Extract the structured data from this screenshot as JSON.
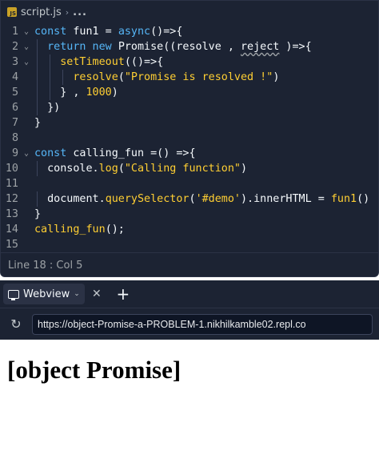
{
  "editor": {
    "breadcrumb": {
      "icon": "js-file-icon",
      "file": "script.js",
      "more": "..."
    },
    "lines": [
      {
        "n": "1",
        "fold": true,
        "indent": 0,
        "tokens": [
          [
            "kw",
            "const "
          ],
          [
            "id",
            "fun1 = "
          ],
          [
            "kw",
            "async"
          ],
          [
            "id",
            "()=>{"
          ]
        ]
      },
      {
        "n": "2",
        "fold": true,
        "indent": 1,
        "tokens": [
          [
            "kw",
            "return new "
          ],
          [
            "id",
            "Promise((resolve , "
          ],
          [
            "sq",
            "reject"
          ],
          [
            "id",
            " )=>{"
          ]
        ]
      },
      {
        "n": "3",
        "fold": true,
        "indent": 2,
        "tokens": [
          [
            "fn",
            "setTimeout"
          ],
          [
            "id",
            "(()=>{"
          ]
        ]
      },
      {
        "n": "4",
        "fold": false,
        "indent": 3,
        "tokens": [
          [
            "fn",
            "resolve"
          ],
          [
            "id",
            "("
          ],
          [
            "str",
            "\"Promise is resolved !\""
          ],
          [
            "id",
            ")"
          ]
        ]
      },
      {
        "n": "5",
        "fold": false,
        "indent": 2,
        "tokens": [
          [
            "id",
            "} , "
          ],
          [
            "num",
            "1000"
          ],
          [
            "id",
            ")"
          ]
        ]
      },
      {
        "n": "6",
        "fold": false,
        "indent": 1,
        "tokens": [
          [
            "id",
            "})"
          ]
        ]
      },
      {
        "n": "7",
        "fold": false,
        "indent": 0,
        "tokens": [
          [
            "id",
            "}"
          ]
        ]
      },
      {
        "n": "8",
        "fold": false,
        "indent": 0,
        "tokens": []
      },
      {
        "n": "9",
        "fold": true,
        "indent": 0,
        "tokens": [
          [
            "kw",
            "const "
          ],
          [
            "id",
            "calling_fun =() =>{"
          ]
        ]
      },
      {
        "n": "10",
        "fold": false,
        "indent": 1,
        "tokens": [
          [
            "id",
            "console."
          ],
          [
            "fn",
            "log"
          ],
          [
            "id",
            "("
          ],
          [
            "str",
            "\"Calling function\""
          ],
          [
            "id",
            ")"
          ]
        ]
      },
      {
        "n": "11",
        "fold": false,
        "indent": 0,
        "tokens": []
      },
      {
        "n": "12",
        "fold": false,
        "indent": 1,
        "tokens": [
          [
            "id",
            "document."
          ],
          [
            "fn",
            "querySelector"
          ],
          [
            "id",
            "("
          ],
          [
            "str",
            "'#demo'"
          ],
          [
            "id",
            ").innerHTML = "
          ],
          [
            "fn",
            "fun1"
          ],
          [
            "id",
            "()"
          ]
        ]
      },
      {
        "n": "13",
        "fold": false,
        "indent": 0,
        "tokens": [
          [
            "id",
            "}"
          ]
        ]
      },
      {
        "n": "14",
        "fold": false,
        "indent": 0,
        "tokens": [
          [
            "fn",
            "calling_fun"
          ],
          [
            "id",
            "();"
          ]
        ]
      },
      {
        "n": "15",
        "fold": false,
        "indent": 0,
        "tokens": []
      }
    ],
    "status": "Line 18 : Col 5"
  },
  "webview": {
    "tab_label": "Webview",
    "tab_icon": "monitor-icon",
    "close_glyph": "✕",
    "new_tab_glyph": "+",
    "reload_glyph": "↻",
    "url": "https://object-Promise-a-PROBLEM-1.nikhilkamble02.repl.co",
    "page_text": "[object Promise]"
  },
  "colors": {
    "editor_bg": "#1c2333",
    "keyword": "#56b6f7",
    "function": "#ffcf33",
    "text": "#f5f9fc",
    "line_number": "#9da2a6"
  }
}
